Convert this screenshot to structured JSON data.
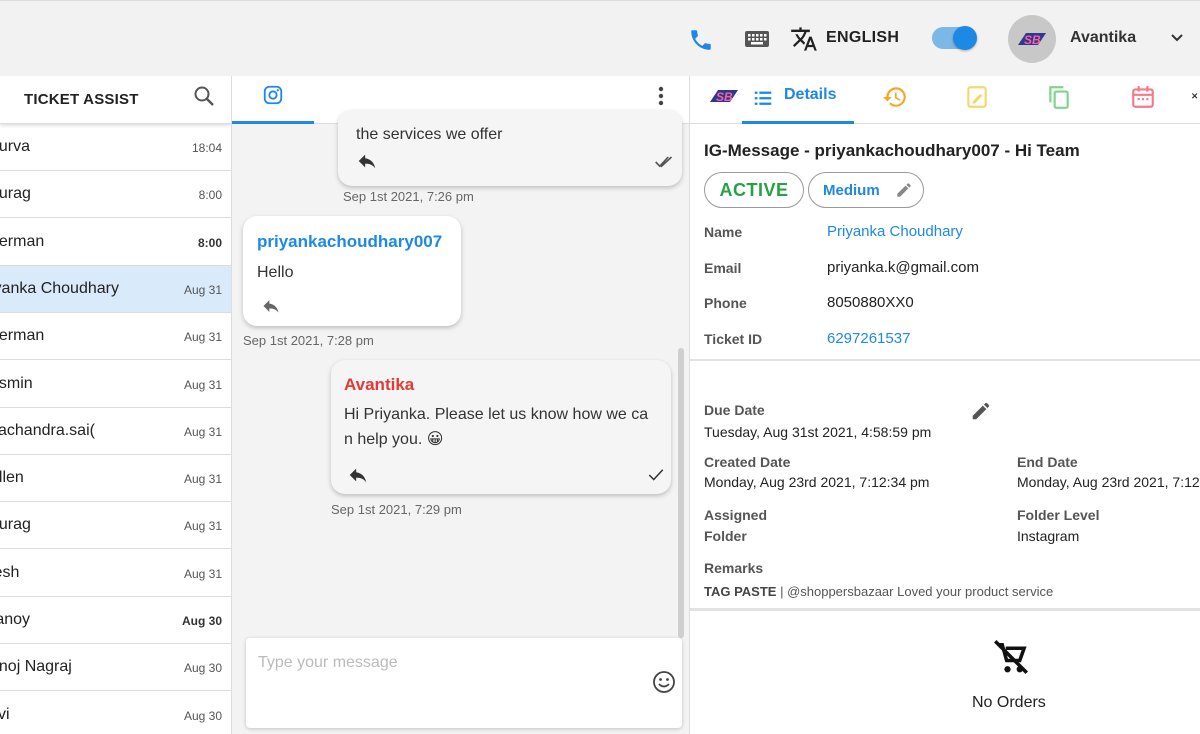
{
  "topbar": {
    "language": "ENGLISH",
    "user_name": "Avantika",
    "logo_text": "SB"
  },
  "left": {
    "title": "TICKET ASSIST",
    "items": [
      {
        "name": "ourva",
        "time": "18:04",
        "bold": false
      },
      {
        "name": "nurag",
        "time": "8:00",
        "bold": false
      },
      {
        "name": "herman",
        "time": "8:00",
        "bold": true
      },
      {
        "name": "iyanka Choudhary",
        "time": "Aug 31",
        "bold": false,
        "selected": true
      },
      {
        "name": "herman",
        "time": "Aug 31",
        "bold": false
      },
      {
        "name": "asmin",
        "time": "Aug 31",
        "bold": false
      },
      {
        "name": "vachandra.sai(",
        "time": "Aug 31",
        "bold": false
      },
      {
        "name": "ellen",
        "time": "Aug 31",
        "bold": false
      },
      {
        "name": "nurag",
        "time": "Aug 31",
        "bold": false
      },
      {
        "name": "jesh",
        "time": "Aug 31",
        "bold": false
      },
      {
        "name": "ranoy",
        "time": "Aug 30",
        "bold": true
      },
      {
        "name": "anoj Nagraj",
        "time": "Aug 30",
        "bold": false
      },
      {
        "name": "zvi",
        "time": "Aug 30",
        "bold": false
      }
    ]
  },
  "chat": {
    "msg1": {
      "text": "the services we offer",
      "stamp": "Sep 1st 2021, 7:26 pm"
    },
    "msg2": {
      "sender": "priyankachoudhary007",
      "text": "Hello",
      "stamp": "Sep 1st 2021, 7:28 pm"
    },
    "msg3": {
      "sender": "Avantika",
      "line1": "Hi Priyanka. Please let us know how we ca",
      "line2": "n help you. 😀",
      "stamp": "Sep 1st 2021, 7:29 pm"
    },
    "input_placeholder": "Type your message"
  },
  "details": {
    "tab_label": "Details",
    "title": "IG-Message - priyankachoudhary007 - Hi Team",
    "status": "ACTIVE",
    "priority": "Medium",
    "fields": [
      {
        "label": "Name",
        "value": "Priyanka Choudhary",
        "link": true
      },
      {
        "label": "Email",
        "value": "priyanka.k@gmail.com",
        "link": false
      },
      {
        "label": "Phone",
        "value": "8050880XX0",
        "link": false
      },
      {
        "label": "Ticket ID",
        "value": "6297261537",
        "link": true
      }
    ],
    "due_label": "Due Date",
    "due_value": "Tuesday, Aug 31st 2021, 4:58:59 pm",
    "created_label": "Created Date",
    "created_value": "Monday, Aug 23rd 2021, 7:12:34 pm",
    "end_label": "End Date",
    "end_value": "Monday, Aug 23rd 2021, 7:12",
    "assigned_label_1": "Assigned",
    "assigned_label_2": "Folder",
    "folder_level_label": "Folder Level",
    "folder_level_value": "Instagram",
    "remarks_label": "Remarks",
    "remarks_tag": "TAG PASTE",
    "remarks_text": " | @shoppersbazaar Loved your product service",
    "no_orders": "No Orders"
  },
  "colors": {
    "accent": "#1e88e5",
    "active_green": "#27a046",
    "agent_red": "#e53935",
    "selected_row": "#d9eafa"
  }
}
